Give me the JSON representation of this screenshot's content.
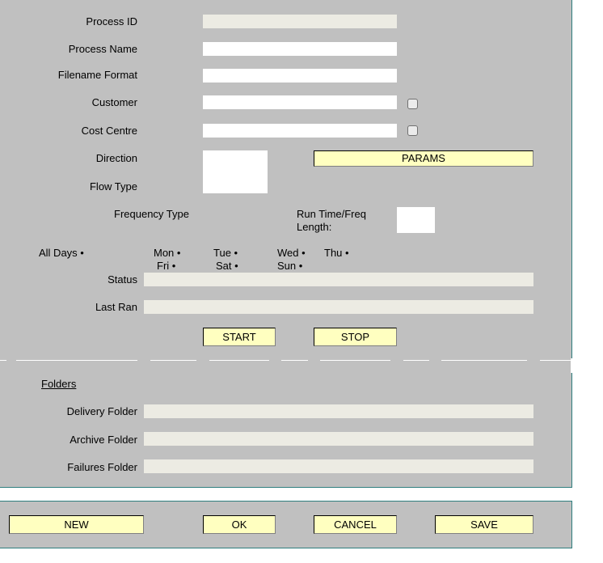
{
  "form": {
    "process_id_label": "Process ID",
    "process_name_label": "Process Name",
    "filename_format_label": "Filename Format",
    "customer_label": "Customer",
    "cost_centre_label": "Cost Centre",
    "direction_label": "Direction",
    "flow_type_label": "Flow Type",
    "frequency_type_label": "Frequency Type",
    "run_time_label_line1": "Run Time/Freq",
    "run_time_label_line2": "Length:",
    "params_button": "PARAMS",
    "status_label": "Status",
    "last_ran_label": "Last Ran",
    "start_button": "START",
    "stop_button": "STOP"
  },
  "days": {
    "all_days": "All Days •",
    "mon": "Mon •",
    "tue": "Tue •",
    "wed": "Wed •",
    "thu": "Thu •",
    "fri": "Fri •",
    "sat": "Sat •",
    "sun": "Sun •"
  },
  "folders": {
    "heading": "Folders",
    "delivery_label": "Delivery Folder",
    "archive_label": "Archive Folder",
    "failures_label": "Failures Folder"
  },
  "footer": {
    "new_button": "NEW",
    "ok_button": "OK",
    "cancel_button": "CANCEL",
    "save_button": "SAVE"
  },
  "colors": {
    "panel_bg": "#c0c0c0",
    "button_bg": "#ffffc0",
    "readonly_field_bg": "#ecebe3",
    "border_teal": "#2f7f7f"
  }
}
